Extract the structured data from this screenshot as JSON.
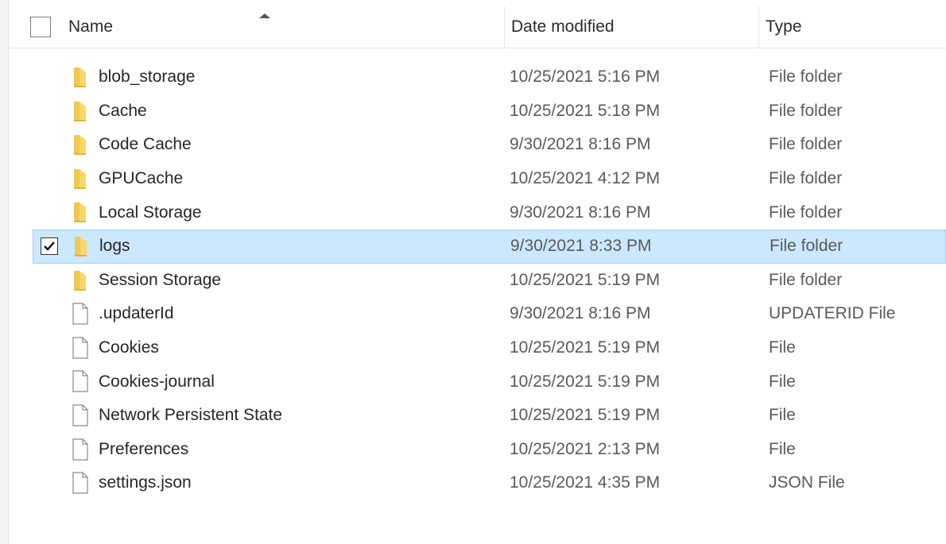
{
  "columns": {
    "name": "Name",
    "date": "Date modified",
    "type": "Type"
  },
  "items": [
    {
      "name": "blob_storage",
      "date": "10/25/2021 5:16 PM",
      "type": "File folder",
      "icon": "folder-icon",
      "selected": false
    },
    {
      "name": "Cache",
      "date": "10/25/2021 5:18 PM",
      "type": "File folder",
      "icon": "folder-icon",
      "selected": false
    },
    {
      "name": "Code Cache",
      "date": "9/30/2021 8:16 PM",
      "type": "File folder",
      "icon": "folder-icon",
      "selected": false
    },
    {
      "name": "GPUCache",
      "date": "10/25/2021 4:12 PM",
      "type": "File folder",
      "icon": "folder-icon",
      "selected": false
    },
    {
      "name": "Local Storage",
      "date": "9/30/2021 8:16 PM",
      "type": "File folder",
      "icon": "folder-icon",
      "selected": false
    },
    {
      "name": "logs",
      "date": "9/30/2021 8:33 PM",
      "type": "File folder",
      "icon": "folder-icon",
      "selected": true
    },
    {
      "name": "Session Storage",
      "date": "10/25/2021 5:19 PM",
      "type": "File folder",
      "icon": "folder-icon",
      "selected": false
    },
    {
      "name": ".updaterId",
      "date": "9/30/2021 8:16 PM",
      "type": "UPDATERID File",
      "icon": "file-icon",
      "selected": false
    },
    {
      "name": "Cookies",
      "date": "10/25/2021 5:19 PM",
      "type": "File",
      "icon": "file-icon",
      "selected": false
    },
    {
      "name": "Cookies-journal",
      "date": "10/25/2021 5:19 PM",
      "type": "File",
      "icon": "file-icon",
      "selected": false
    },
    {
      "name": "Network Persistent State",
      "date": "10/25/2021 5:19 PM",
      "type": "File",
      "icon": "file-icon",
      "selected": false
    },
    {
      "name": "Preferences",
      "date": "10/25/2021 2:13 PM",
      "type": "File",
      "icon": "file-icon",
      "selected": false
    },
    {
      "name": "settings.json",
      "date": "10/25/2021 4:35 PM",
      "type": "JSON File",
      "icon": "file-icon",
      "selected": false
    }
  ],
  "colors": {
    "selection_bg": "#cce8ff",
    "selection_border": "#99d1ff",
    "folder": "#f2c94c"
  },
  "sort": {
    "column": "name",
    "direction": "ascending",
    "icon": "sort-ascending-icon"
  }
}
